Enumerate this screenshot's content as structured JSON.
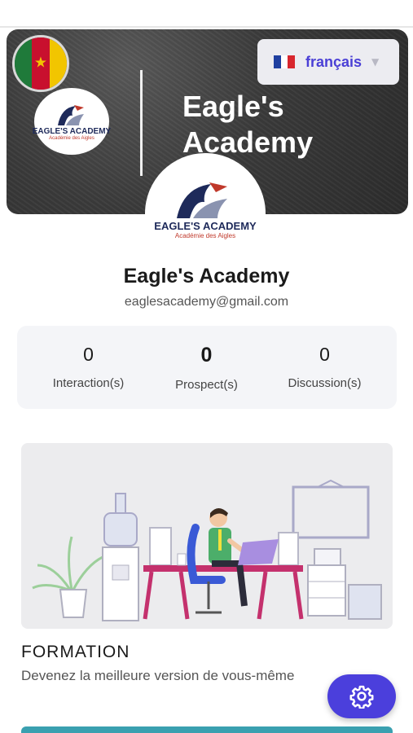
{
  "language": {
    "label": "français",
    "flag": "fr-flag-icon"
  },
  "banner": {
    "title_line1": "Eagle's",
    "title_line2": "Academy",
    "country_flag": "cameroon-flag-icon",
    "logo_brand": "EAGLE'S ACADEMY",
    "logo_sub": "Académie des Aigles"
  },
  "profile": {
    "name": "Eagle's Academy",
    "email": "eaglesacademy@gmail.com"
  },
  "stats": [
    {
      "value": "0",
      "label": "Interaction(s)"
    },
    {
      "value": "0",
      "label": "Prospect(s)"
    },
    {
      "value": "0",
      "label": "Discussion(s)"
    }
  ],
  "card": {
    "title": "FORMATION",
    "subtitle": "Devenez la meilleure version de vous-même"
  },
  "fab": {
    "icon": "gear-icon"
  },
  "colors": {
    "accent": "#4b3fdc",
    "language_text": "#4a3fd6",
    "brand_navy": "#1e2a5a",
    "brand_red": "#c0392b"
  }
}
